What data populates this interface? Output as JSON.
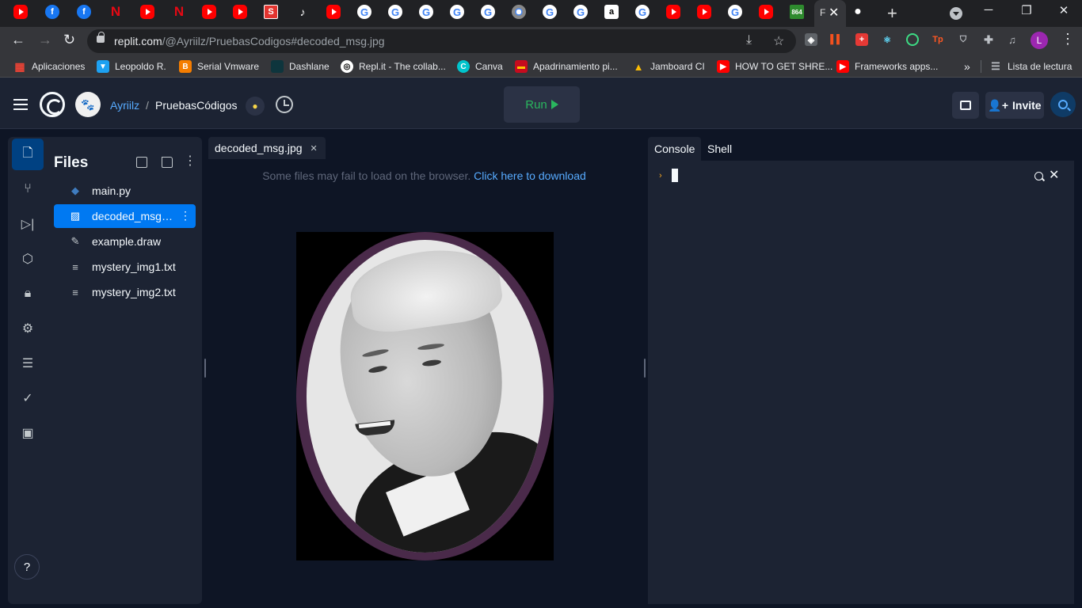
{
  "browser": {
    "active_tab_letter": "F",
    "url_host": "replit.com",
    "url_path": "/@Ayriilz/PruebasCodigos#decoded_msg.jpg",
    "profile_initial": "L",
    "bookmarks": [
      {
        "label": "Aplicaciones",
        "icon": "apps-grid-icon"
      },
      {
        "label": "Leopoldo R.",
        "icon": "bird-icon"
      },
      {
        "label": "Serial Vmware",
        "icon": "blogger-icon"
      },
      {
        "label": "Dashlane",
        "icon": "dashlane-icon"
      },
      {
        "label": "Repl.it - The collab...",
        "icon": "replit-icon"
      },
      {
        "label": "Canva",
        "icon": "canva-icon"
      },
      {
        "label": "Apadrinamiento pi...",
        "icon": "flag-icon"
      },
      {
        "label": "Jamboard CI",
        "icon": "drive-icon"
      },
      {
        "label": "HOW TO GET SHRE...",
        "icon": "youtube-icon"
      },
      {
        "label": "Frameworks apps...",
        "icon": "youtube-icon"
      }
    ],
    "reading_list": "Lista de lectura",
    "more_bookmarks": "»"
  },
  "header": {
    "owner": "Ayriilz",
    "separator": "/",
    "project": "PruebasCódigos",
    "run_label": "Run",
    "invite_label": "Invite"
  },
  "files": {
    "title": "Files",
    "items": [
      {
        "name": "main.py",
        "icon": "python-icon"
      },
      {
        "name": "decoded_msg.jpg",
        "icon": "image-icon",
        "selected": true
      },
      {
        "name": "example.draw",
        "icon": "pen-icon"
      },
      {
        "name": "mystery_img1.txt",
        "icon": "text-file-icon"
      },
      {
        "name": "mystery_img2.txt",
        "icon": "text-file-icon"
      }
    ]
  },
  "editor": {
    "tab_label": "decoded_msg.jpg",
    "notice_text": "Some files may fail to load on the browser.",
    "notice_link": "Click here to download"
  },
  "console": {
    "tabs": [
      "Console",
      "Shell"
    ],
    "prompt": "›"
  },
  "help_label": "?",
  "colors": {
    "accent": "#0079f2",
    "run_green": "#2ab65e",
    "link_blue": "#57abff"
  }
}
